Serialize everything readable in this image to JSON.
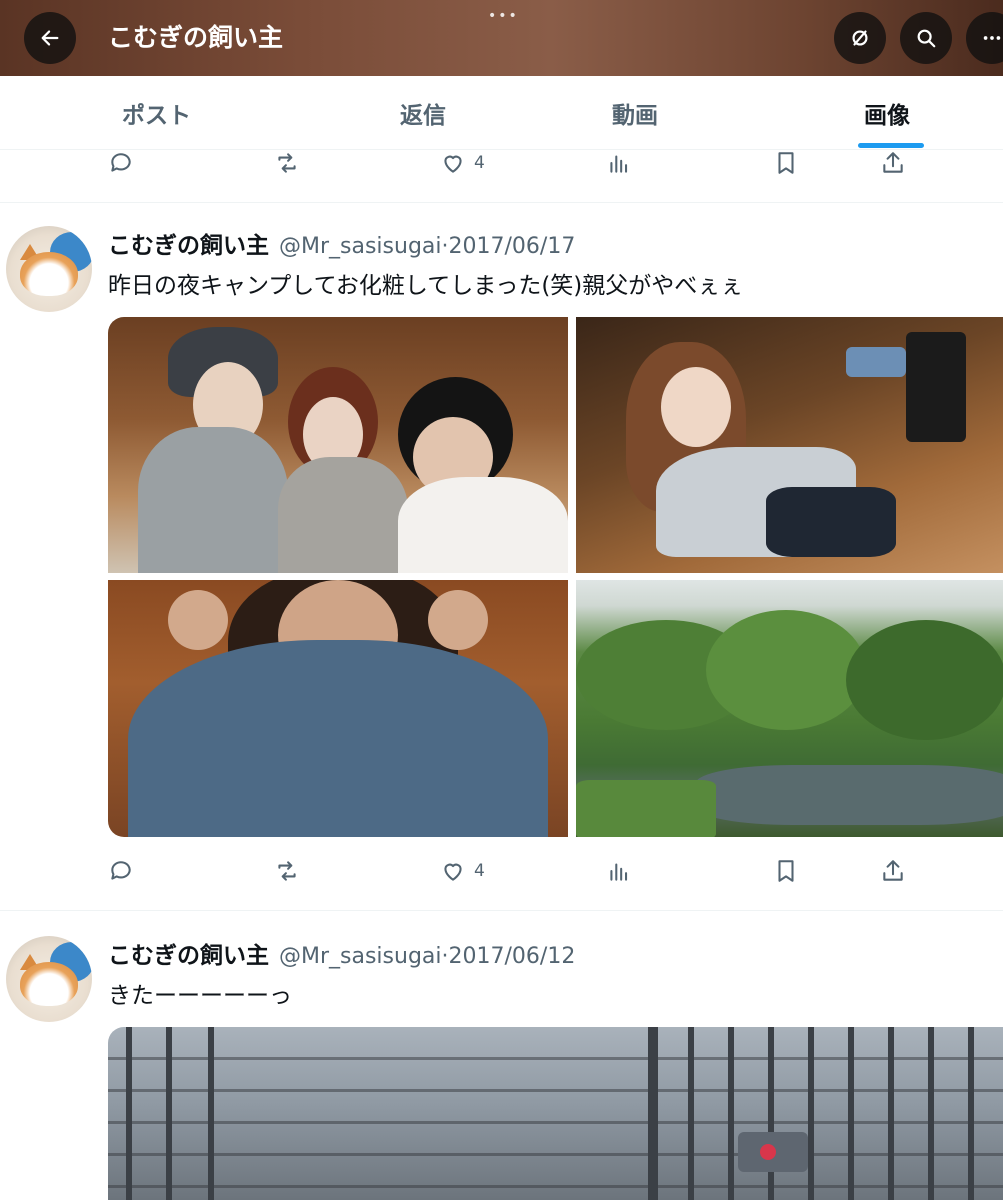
{
  "header": {
    "title": "こむぎの飼い主",
    "handle_dots": "•••"
  },
  "tabs": [
    {
      "label": "ポスト",
      "active": false
    },
    {
      "label": "返信",
      "active": false
    },
    {
      "label": "動画",
      "active": false
    },
    {
      "label": "画像",
      "active": true
    }
  ],
  "top_actions": {
    "like_count": "4"
  },
  "tweets": [
    {
      "name": "こむぎの飼い主",
      "handle": "@Mr_sasisugai",
      "date": "2017/06/17",
      "text": "昨日の夜キャンプしてお化粧してしまった(笑)親父がやべぇぇ",
      "like_count": "4"
    },
    {
      "name": "こむぎの飼い主",
      "handle": "@Mr_sasisugai",
      "date": "2017/06/12",
      "text": "きたーーーーーっ"
    }
  ],
  "separator": "·",
  "colors": {
    "accent": "#1d9bf0",
    "text_primary": "#0f1419",
    "text_secondary": "#536471"
  }
}
